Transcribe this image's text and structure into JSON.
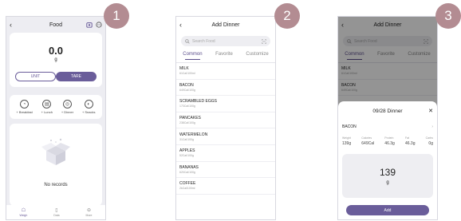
{
  "colors": {
    "accent": "#6a5d9a",
    "step_badge": "#b38c92",
    "panel_bg": "#ededf2"
  },
  "steps": [
    "1",
    "2",
    "3"
  ],
  "screen1": {
    "header": {
      "back_icon": "‹",
      "title": "Food",
      "icons": [
        "scale-icon",
        "more-icon"
      ]
    },
    "scale": {
      "reading": "0.0",
      "unit": "g",
      "unit_button": "UNIT",
      "tare_button": "TARE"
    },
    "meals": [
      {
        "icon": "breakfast-icon",
        "label": "+ Breakfast"
      },
      {
        "icon": "lunch-icon",
        "label": "+ Lunch"
      },
      {
        "icon": "dinner-icon",
        "label": "+ Dinner"
      },
      {
        "icon": "snacks-icon",
        "label": "+ Snacks"
      }
    ],
    "empty_text": "No records",
    "tabbar": [
      {
        "icon": "scale-icon",
        "label": "Weigh"
      },
      {
        "icon": "data-icon",
        "label": "Data"
      },
      {
        "icon": "more-icon",
        "label": "More"
      }
    ]
  },
  "screen2": {
    "header": {
      "back_icon": "‹",
      "title": "Add Dinner"
    },
    "search": {
      "placeholder": "Search Food"
    },
    "tabs": [
      "Common",
      "Favorite",
      "Customize"
    ],
    "items": [
      {
        "name": "MILK",
        "desc": "61Cal/100ml"
      },
      {
        "name": "BACON",
        "desc": "649Cal/100g"
      },
      {
        "name": "SCRAMBLED EGGS",
        "desc": "173Cal/100g"
      },
      {
        "name": "PANCAKES",
        "desc": "238Cal/100g"
      },
      {
        "name": "WATERMELON",
        "desc": "31Cal/100g"
      },
      {
        "name": "APPLES",
        "desc": "52Cal/100g"
      },
      {
        "name": "BANANAS",
        "desc": "620Cal/100g"
      },
      {
        "name": "COFFEE",
        "desc": "2kCal/100ml"
      }
    ]
  },
  "screen3": {
    "header": {
      "back_icon": "‹",
      "title": "Add Dinner"
    },
    "search": {
      "placeholder": "Search Food"
    },
    "tabs": [
      "Common",
      "Favorite",
      "Customize"
    ],
    "items": [
      {
        "name": "MILK",
        "desc": "61Cal/100ml"
      },
      {
        "name": "BACON",
        "desc": "649Cal/100g"
      }
    ],
    "sheet": {
      "title": "09/28 Dinner",
      "close_icon": "✕",
      "food": "BACON",
      "nutrition": [
        {
          "label": "Weight",
          "value": "139g"
        },
        {
          "label": "Calories",
          "value": "649Cal"
        },
        {
          "label": "Protein",
          "value": "46.3g"
        },
        {
          "label": "Fat",
          "value": "46.3g"
        },
        {
          "label": "Carbs",
          "value": "0g"
        }
      ],
      "weight_value": "139",
      "weight_unit": "g",
      "add_button": "Add"
    }
  }
}
